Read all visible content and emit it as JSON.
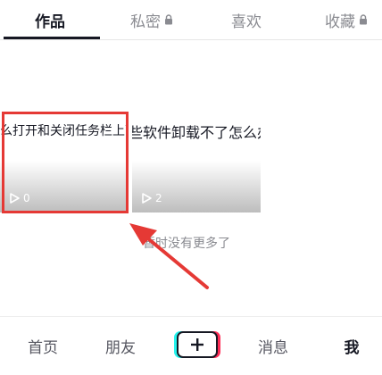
{
  "tabs": {
    "works": "作品",
    "private": "私密",
    "likes": "喜欢",
    "favorites": "收藏"
  },
  "videos": [
    {
      "title": "么打开和关闭任务栏上面",
      "play_count": "0"
    },
    {
      "title": "些软件卸载不了怎么办",
      "play_count": "2"
    }
  ],
  "no_more_text": "暂时没有更多了",
  "bottom_nav": {
    "home": "首页",
    "friends": "朋友",
    "messages": "消息",
    "me": "我"
  },
  "colors": {
    "highlight": "#e53935",
    "text_primary": "#161823",
    "text_secondary": "#8a8b91"
  },
  "icons": {
    "lock": "lock-icon",
    "play": "play-icon",
    "plus": "plus-icon",
    "arrow": "arrow-annotation"
  }
}
